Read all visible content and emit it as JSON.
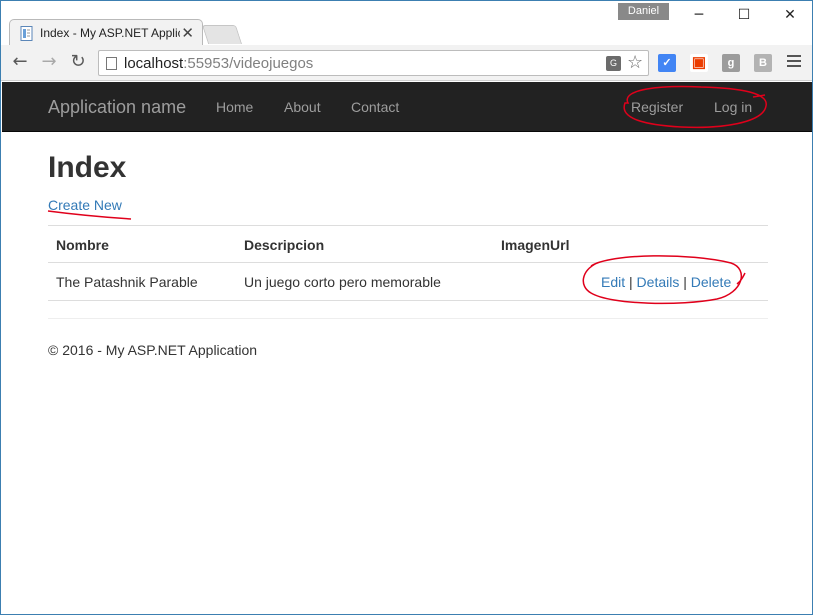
{
  "browser": {
    "tab_title": "Index - My ASP.NET Applic",
    "tab_close": "✕",
    "user_name": "Daniel",
    "address": {
      "host": "localhost",
      "path": ":55953/videojuegos"
    }
  },
  "site": {
    "brand": "Application name",
    "nav": {
      "home": "Home",
      "about": "About",
      "contact": "Contact"
    },
    "auth": {
      "register": "Register",
      "login": "Log in"
    }
  },
  "main": {
    "title": "Index",
    "create_new": "Create New",
    "table": {
      "headers": {
        "nombre": "Nombre",
        "descripcion": "Descripcion",
        "imagen": "ImagenUrl"
      },
      "rows": [
        {
          "nombre": "The Patashnik Parable",
          "descripcion": "Un juego corto pero memorable",
          "imagen": "",
          "edit": "Edit",
          "details": "Details",
          "delete": "Delete"
        }
      ],
      "separator": "|"
    }
  },
  "footer": {
    "text": "© 2016 - My ASP.NET Application"
  },
  "colors": {
    "navbar": "#222222",
    "link": "#337ab7",
    "annotation": "#e0001b"
  }
}
